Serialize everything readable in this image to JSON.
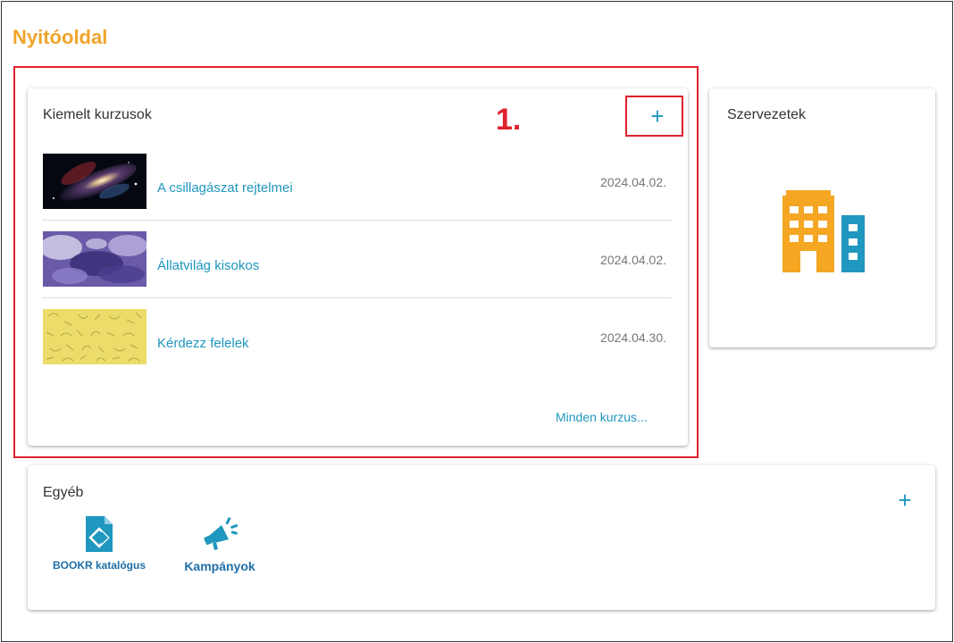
{
  "page": {
    "title": "Nyitóoldal"
  },
  "annotation": {
    "step": "1."
  },
  "featured": {
    "title": "Kiemelt kurzusok",
    "add_label": "+",
    "all_label": "Minden kurzus...",
    "courses": [
      {
        "name": "A csillagászat rejtelmei",
        "date": "2024.04.02."
      },
      {
        "name": "Állatvilág kisokos",
        "date": "2024.04.02."
      },
      {
        "name": "Kérdezz felelek",
        "date": "2024.04.30."
      }
    ]
  },
  "organizations": {
    "title": "Szervezetek",
    "icon": "building-icon"
  },
  "other": {
    "title": "Egyéb",
    "add_label": "+",
    "items": [
      {
        "label": "BOOKR katalógus",
        "icon": "document-icon"
      },
      {
        "label": "Kampányok",
        "icon": "megaphone-icon"
      }
    ]
  },
  "colors": {
    "accent": "#1f97bf",
    "title": "#f0a42a",
    "highlight": "#e0212e",
    "orange": "#f5a623"
  }
}
